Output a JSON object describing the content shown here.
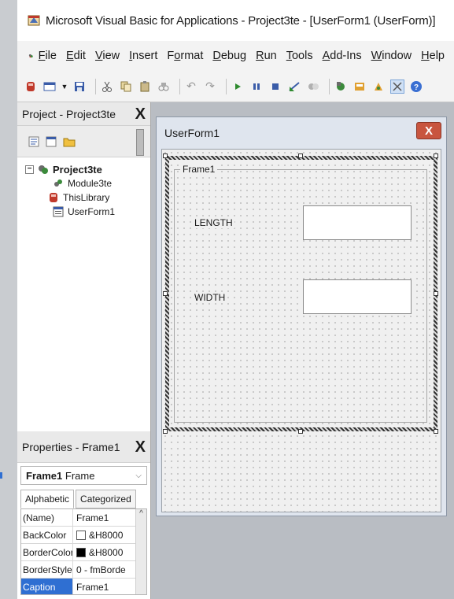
{
  "window": {
    "title": "Microsoft Visual Basic for Applications - Project3te - [UserForm1 (UserForm)]"
  },
  "menu": {
    "items": [
      {
        "accel": "F",
        "rest": "ile"
      },
      {
        "accel": "E",
        "rest": "dit"
      },
      {
        "accel": "V",
        "rest": "iew"
      },
      {
        "accel": "I",
        "rest": "nsert"
      },
      {
        "accel": "",
        "rest": "F",
        "accel2": "o",
        "rest2": "rmat"
      },
      {
        "accel": "D",
        "rest": "ebug"
      },
      {
        "accel": "R",
        "rest": "un"
      },
      {
        "accel": "T",
        "rest": "ools"
      },
      {
        "accel": "A",
        "rest": "dd-Ins"
      },
      {
        "accel": "W",
        "rest": "indow"
      },
      {
        "accel": "H",
        "rest": "elp"
      }
    ]
  },
  "project": {
    "title": "Project - Project3te",
    "close": "X",
    "tree": {
      "root": "Project3te",
      "children": [
        "Module3te",
        "ThisLibrary",
        "UserForm1"
      ]
    }
  },
  "properties": {
    "title": "Properties - Frame1",
    "close": "X",
    "object_name": "Frame1",
    "object_type": "Frame",
    "tabs": [
      "Alphabetic",
      "Categorized"
    ],
    "rows": [
      {
        "name": "(Name)",
        "value": "Frame1",
        "swatch": ""
      },
      {
        "name": "BackColor",
        "value": "&H8000",
        "swatch": "#ffffff"
      },
      {
        "name": "BorderColor",
        "value": "&H8000",
        "swatch": "#000000"
      },
      {
        "name": "BorderStyle",
        "value": "0 - fmBorde",
        "swatch": ""
      },
      {
        "name": "Caption",
        "value": "Frame1",
        "swatch": ""
      }
    ],
    "selected_row": "Caption"
  },
  "userform": {
    "title": "UserForm1",
    "close": "X",
    "frame_caption": "Frame1",
    "labels": [
      "LENGTH",
      "WIDTH"
    ]
  },
  "colors": {
    "selection_blue": "#2f6fd2",
    "close_red": "#c8553f",
    "form_bg": "#dfe5ee"
  }
}
